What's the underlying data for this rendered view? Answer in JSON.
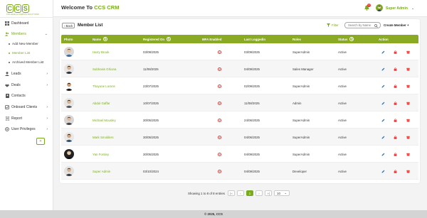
{
  "brand": {
    "logo": "CCS",
    "tagline": "COLLEGE & CAMPUS SOLUTIONS"
  },
  "header": {
    "welcome_prefix": "Welcome To ",
    "welcome_brand": "CCS CRM",
    "notification_count": "0",
    "user_name": "Super Admin"
  },
  "sidebar": {
    "items": [
      {
        "label": "Dashboard",
        "icon": "dashboard-icon"
      },
      {
        "label": "Members",
        "icon": "members-icon"
      },
      {
        "label": "Leads",
        "icon": "leads-icon"
      },
      {
        "label": "Deals",
        "icon": "deals-icon"
      },
      {
        "label": "Contacts",
        "icon": "contacts-icon"
      },
      {
        "label": "Onboard Clients",
        "icon": "onboard-icon"
      },
      {
        "label": "Report",
        "icon": "report-icon"
      },
      {
        "label": "User Privileges",
        "icon": "privileges-icon"
      }
    ],
    "members_sub": [
      "Add New Member",
      "Member List",
      "Archived Member List"
    ],
    "collapse": "«"
  },
  "card": {
    "back_label": "Back",
    "title": "Member List",
    "filter_label": "Filter",
    "search_placeholder": "Search by Name",
    "create_label": "Create Member +"
  },
  "table": {
    "headers": [
      "Photo",
      "Name",
      "Registered On",
      "MFA Enabled",
      "Last Loggedin",
      "Roles",
      "Status",
      "Action"
    ],
    "rows": [
      {
        "name": "Harry Brook",
        "registered": "03/09/2025",
        "last": "03/09/2025",
        "role": "SuperAdmin",
        "status": "Active"
      },
      {
        "name": "Subhasis Ghiona",
        "registered": "11/08/2025",
        "last": "04/09/2025",
        "role": "Sales Manager",
        "status": "Active"
      },
      {
        "name": "Thayone Lorens",
        "registered": "23/07/2025",
        "last": "02/09/2025",
        "role": "SuperAdmin",
        "status": "Active"
      },
      {
        "name": "Abdul Gaffar",
        "registered": "10/07/2025",
        "last": "11/08/2025",
        "role": "Admin",
        "status": "Active"
      },
      {
        "name": "Michael Mousley",
        "registered": "30/05/2025",
        "last": "24/06/2025",
        "role": "SuperAdmin",
        "status": "Active"
      },
      {
        "name": "Mark Smolders",
        "registered": "30/05/2025",
        "last": "04/06/2025",
        "role": "SuperAdmin",
        "status": "Active"
      },
      {
        "name": "Yan Forsley",
        "registered": "30/05/2025",
        "last": "04/09/2025",
        "role": "SuperAdmin",
        "status": "Active"
      },
      {
        "name": "Super Admin",
        "registered": "03/10/2024",
        "last": "04/09/2025",
        "role": "Developer",
        "status": "Active"
      }
    ]
  },
  "pagination": {
    "summary": "Showing 1 to 8 of 8 entries",
    "first": "|«",
    "prev": "‹",
    "page": "1",
    "next": "›",
    "last": "»|",
    "page_size": "10"
  },
  "footer": {
    "text": "© 2025, CCS"
  },
  "colors": {
    "accent": "#7aab1e",
    "header_row": "#8aaa24",
    "danger": "#e53935",
    "edit": "#1e73be"
  }
}
